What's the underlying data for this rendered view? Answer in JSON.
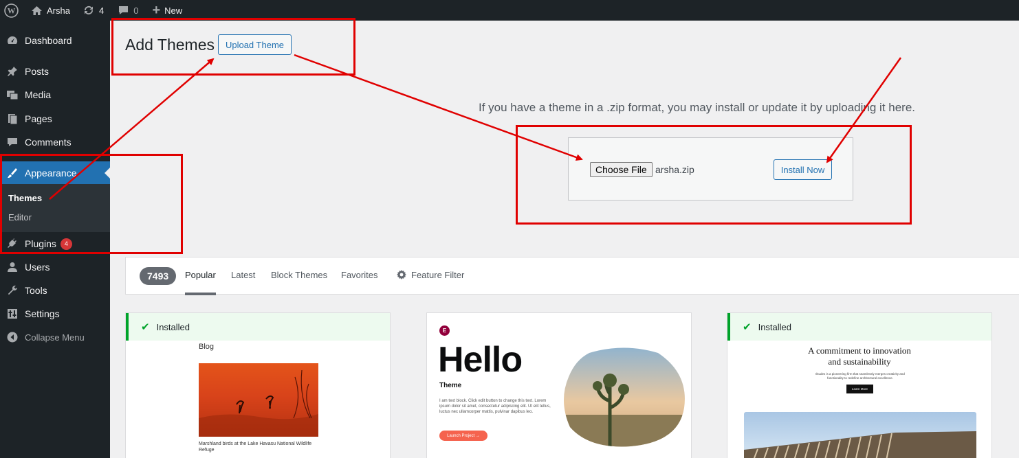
{
  "admin_bar": {
    "site_name": "Arsha",
    "updates_count": "4",
    "comments_count": "0",
    "new_label": "New"
  },
  "sidebar": {
    "items": [
      {
        "label": "Dashboard",
        "icon": "dashboard-icon"
      },
      {
        "label": "Posts",
        "icon": "pin-icon"
      },
      {
        "label": "Media",
        "icon": "media-icon"
      },
      {
        "label": "Pages",
        "icon": "pages-icon"
      },
      {
        "label": "Comments",
        "icon": "comment-icon"
      },
      {
        "label": "Appearance",
        "icon": "brush-icon"
      },
      {
        "label": "Plugins",
        "icon": "plug-icon",
        "badge": "4"
      },
      {
        "label": "Users",
        "icon": "user-icon"
      },
      {
        "label": "Tools",
        "icon": "wrench-icon"
      },
      {
        "label": "Settings",
        "icon": "settings-icon"
      },
      {
        "label": "Collapse Menu",
        "icon": "collapse-icon"
      }
    ],
    "appearance_submenu": [
      "Themes",
      "Editor"
    ],
    "active_item": "Appearance",
    "current_subitem": "Themes"
  },
  "main": {
    "page_title": "Add Themes",
    "upload_theme_button": "Upload Theme",
    "upload_help": "If you have a theme in a .zip format, you may install or update it by uploading it here.",
    "choose_file_button": "Choose File",
    "selected_file": "arsha.zip",
    "install_now_button": "Install Now"
  },
  "filter_bar": {
    "theme_count": "7493",
    "tabs": [
      "Popular",
      "Latest",
      "Block Themes",
      "Favorites"
    ],
    "current_tab": "Popular",
    "feature_filter": "Feature Filter"
  },
  "themes": [
    {
      "installed_label": "Installed",
      "preview": {
        "heading": "Blog",
        "caption": "Marshland birds at the Lake Havasu National Wildlife Refuge"
      }
    },
    {
      "installed_label": "",
      "preview": {
        "heading": "Hello",
        "subheading": "Theme",
        "body": "I am text block. Click edit button to change this text. Lorem ipsum dolor sit amet, consectetur adipiscing elit. Ut elit tellus, luctus nec ullamcorper mattis, pulvinar dapibus leo.",
        "button": "Launch Project →"
      }
    },
    {
      "installed_label": "Installed",
      "preview": {
        "heading_line1": "A commitment to innovation",
        "heading_line2": "and sustainability",
        "body": "Études is a pioneering firm that seamlessly merges creativity and functionality to redefine architectural excellence.",
        "button": "Learn More"
      }
    }
  ],
  "colors": {
    "admin_bar_bg": "#1d2327",
    "accent": "#2271b1",
    "installed_green": "#00a32a",
    "annotation_red": "#e00000",
    "badge_red": "#d63638"
  }
}
